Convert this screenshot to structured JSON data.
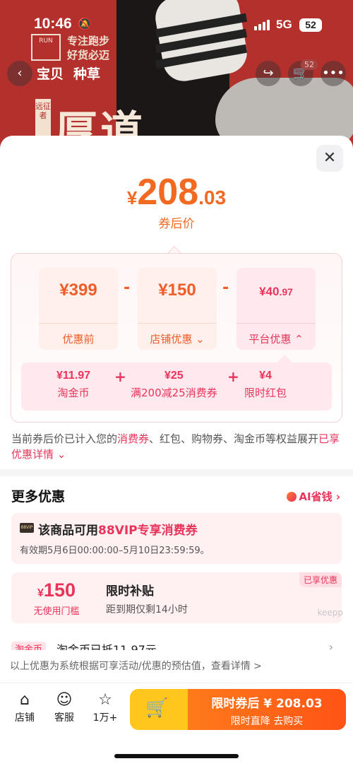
{
  "status": {
    "time": "10:46",
    "network": "5G",
    "battery": "52"
  },
  "brand": {
    "logo_text": "RUN",
    "slogan_line1": "专注跑步",
    "slogan_line2": "好货必迈",
    "poster_text": "厚道",
    "poster_tag": "远征者"
  },
  "nav": {
    "tab1": "宝贝",
    "tab2": "种草",
    "cart_count": "52"
  },
  "price": {
    "currency": "¥",
    "integer": "208",
    "decimal": ".03",
    "caption": "券后价"
  },
  "breakdown": {
    "original": {
      "value": "¥399",
      "label": "优惠前"
    },
    "minus": "-",
    "shop": {
      "value": "¥150",
      "label": "店铺优惠"
    },
    "platform": {
      "value_int": "¥40",
      "value_dec": ".97",
      "label": "平台优惠"
    },
    "sub_items": [
      {
        "value": "¥11.97",
        "label": "淘金币"
      },
      {
        "value": "¥25",
        "label": "满200减25消费券"
      },
      {
        "value": "¥4",
        "label": "限时红包"
      }
    ],
    "plus": "+"
  },
  "note": {
    "prefix": "当前券后价已计入您的",
    "coupon": "消费券",
    "middle": "、红包、购物券、淘金币等权益展开",
    "details": "已享优惠详情"
  },
  "more": {
    "title": "更多优惠",
    "ai_label": "AI省钱",
    "vip": {
      "badge": "88VIP",
      "title_prefix": "该商品可用",
      "title_highlight": "88VIP专享消费券",
      "validity": "有效期5月6日00:00:00–5月10日23:59:59。"
    },
    "subsidy": {
      "currency": "¥",
      "amount": "150",
      "condition": "无使用门槛",
      "title": "限时补贴",
      "desc": "距到期仅剩14小时",
      "tag": "已享优惠"
    },
    "coin": {
      "tag": "淘金币",
      "title": "淘金币已抵11.97元"
    }
  },
  "disclaimer": "以上优惠为系统根据可享活动/优惠的预估值，查看详情 >",
  "actions": {
    "store": "店铺",
    "service": "客服",
    "favorite": "1万+",
    "buy_line1": "限时券后 ¥ 208.03",
    "buy_line2": "限时直降  去购买"
  },
  "watermark": "keepp"
}
